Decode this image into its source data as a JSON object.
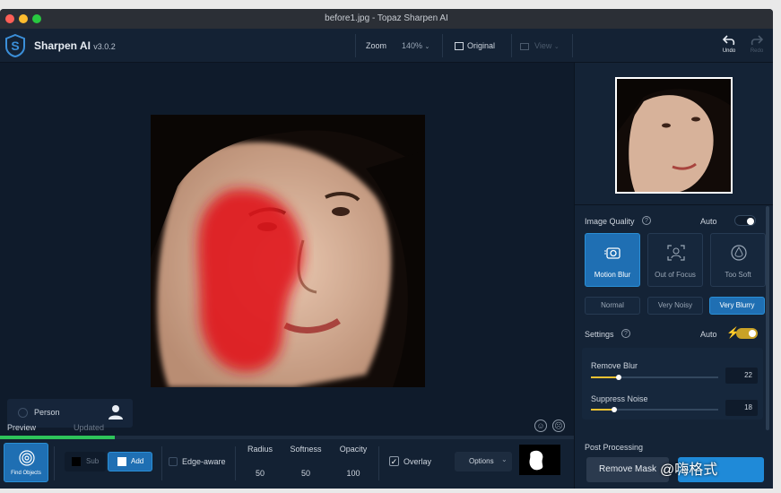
{
  "window": {
    "title": "before1.jpg - Topaz Sharpen AI"
  },
  "app": {
    "name": "Sharpen AI",
    "version": "v3.0.2"
  },
  "toolbar": {
    "zoom_label": "Zoom",
    "zoom_value": "140%",
    "original_label": "Original",
    "view_label": "View",
    "undo_label": "Undo",
    "redo_label": "Redo"
  },
  "canvas": {
    "person_label": "Person",
    "tabs": {
      "preview": "Preview",
      "updated": "Updated"
    },
    "progress": 0.2
  },
  "bottom": {
    "find_objects": "Find Objects",
    "sub": "Sub",
    "add": "Add",
    "edge_aware": "Edge-aware",
    "radius_label": "Radius",
    "radius_value": "50",
    "softness_label": "Softness",
    "softness_value": "50",
    "opacity_label": "Opacity",
    "opacity_value": "100",
    "overlay": "Overlay",
    "options": "Options"
  },
  "panel": {
    "image_quality": "Image Quality",
    "auto": "Auto",
    "modes": [
      "Motion Blur",
      "Out of Focus",
      "Too Soft"
    ],
    "levels": [
      "Normal",
      "Very Noisy",
      "Very Blurry"
    ],
    "settings": "Settings",
    "settings_auto": "Auto",
    "remove_blur_label": "Remove Blur",
    "remove_blur_value": "22",
    "suppress_noise_label": "Suppress Noise",
    "suppress_noise_value": "18",
    "post_processing": "Post Processing",
    "remove_mask": "Remove Mask"
  },
  "watermark": "@嗨格式",
  "colors": {
    "accent": "#2a8fd6",
    "mask": "#e0191c",
    "bg": "#0f1b2b",
    "toggle_on": "#c9a227"
  }
}
